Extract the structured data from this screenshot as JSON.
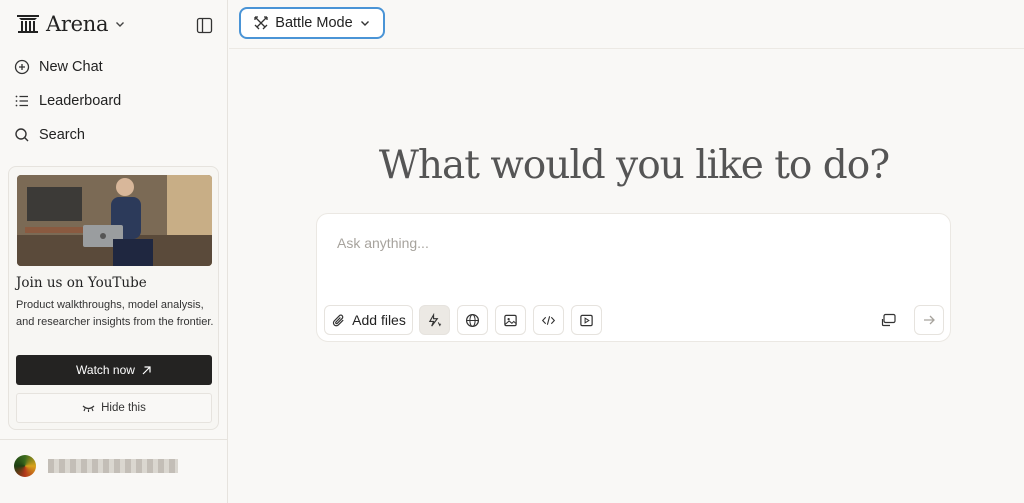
{
  "app": {
    "brand": "Arena",
    "mode_label": "Battle Mode"
  },
  "sidebar": {
    "nav": [
      {
        "label": "New Chat",
        "icon": "plus-circle-icon"
      },
      {
        "label": "Leaderboard",
        "icon": "list-icon"
      },
      {
        "label": "Search",
        "icon": "search-icon"
      }
    ],
    "promo": {
      "title": "Join us on YouTube",
      "description": "Product walkthroughs, model analysis, and researcher insights from the frontier.",
      "watch_label": "Watch now",
      "hide_label": "Hide this"
    }
  },
  "main": {
    "headline": "What would you like to do?",
    "composer": {
      "placeholder": "Ask anything...",
      "value": "",
      "add_files_label": "Add files"
    }
  },
  "colors": {
    "mode_border": "#4a94d6",
    "watch_button": "#242322",
    "background": "#f9f8f6"
  }
}
